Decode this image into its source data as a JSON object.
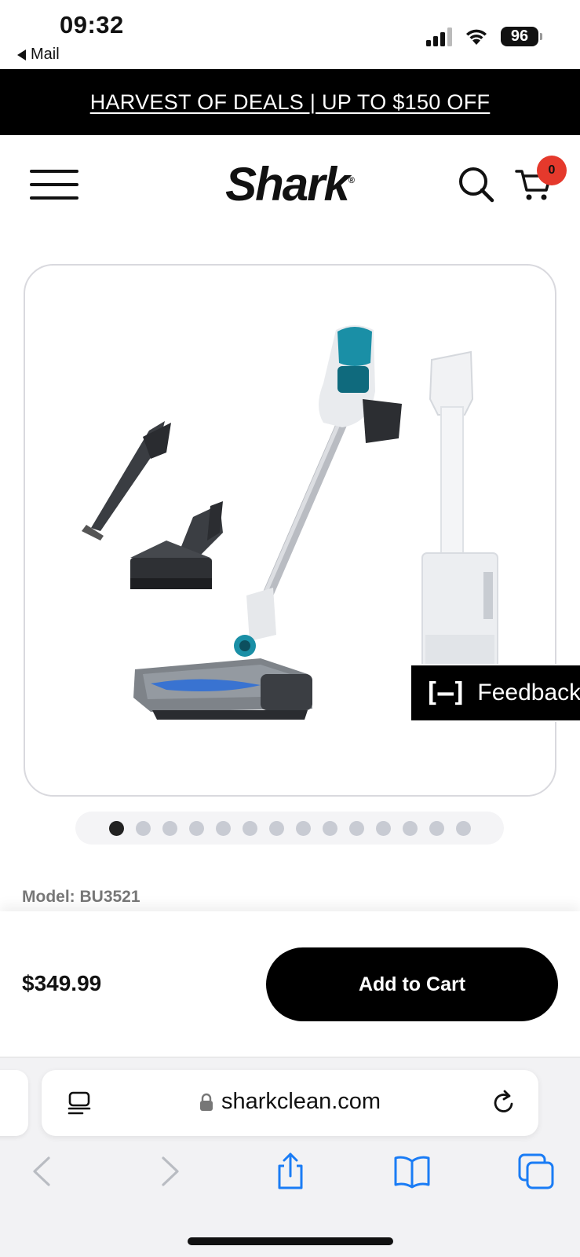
{
  "status_bar": {
    "time": "09:32",
    "back_label": "Mail",
    "battery": "96"
  },
  "promo": {
    "text": "HARVEST OF DEALS | UP TO $150 OFF"
  },
  "header": {
    "logo": "Shark",
    "logo_mark": "®",
    "cart_count": "0"
  },
  "gallery": {
    "dot_count": 14,
    "active_index": 0,
    "feedback_label": "Feedback",
    "feedback_icon_text": "[–]"
  },
  "product": {
    "model": "Model: BU3521",
    "price": "$349.99",
    "add_to_cart": "Add to Cart"
  },
  "browser": {
    "url": "sharkclean.com"
  },
  "colors": {
    "promo_bg": "#000000",
    "cart_badge": "#e5392c",
    "safari_blue": "#1a7cf5",
    "vacuum_accent": "#1a8fa6"
  }
}
